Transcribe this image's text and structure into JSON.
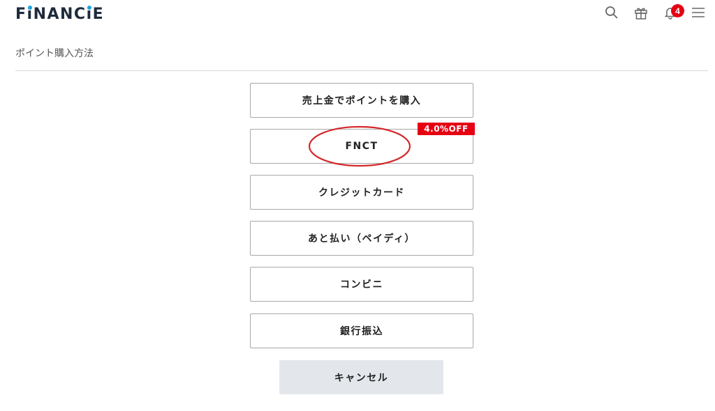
{
  "header": {
    "logo_parts": [
      "F",
      "i",
      "NANC",
      "i",
      "E"
    ],
    "notification_count": "4",
    "icons": [
      "search-icon",
      "gift-icon",
      "bell-icon",
      "hamburger-menu-icon"
    ]
  },
  "page": {
    "title": "ポイント購入方法"
  },
  "methods": [
    {
      "label": "売上金でポイントを購入"
    },
    {
      "label": "FNCT",
      "badge": "4.0%OFF"
    },
    {
      "label": "クレジットカード"
    },
    {
      "label": "あと払い（ペイディ）"
    },
    {
      "label": "コンビニ"
    },
    {
      "label": "銀行振込"
    }
  ],
  "cancel_label": "キャンセル",
  "colors": {
    "accent_red": "#e60012",
    "logo_dot_blue": "#1fa3e0",
    "annotation_circle": "#d4282c",
    "cancel_bg": "#e3e7ec"
  }
}
